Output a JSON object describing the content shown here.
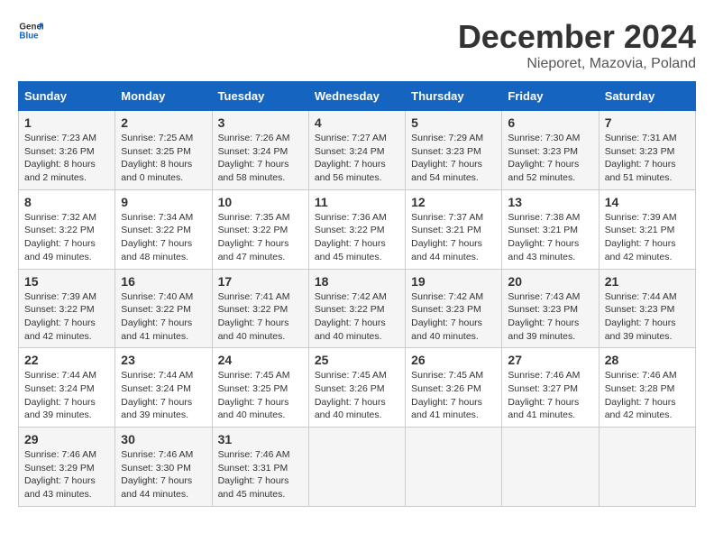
{
  "header": {
    "logo_general": "General",
    "logo_blue": "Blue",
    "main_title": "December 2024",
    "subtitle": "Nieporet, Mazovia, Poland"
  },
  "calendar": {
    "columns": [
      "Sunday",
      "Monday",
      "Tuesday",
      "Wednesday",
      "Thursday",
      "Friday",
      "Saturday"
    ],
    "weeks": [
      [
        {
          "day": "1",
          "sunrise": "7:23 AM",
          "sunset": "3:26 PM",
          "daylight": "8 hours and 2 minutes."
        },
        {
          "day": "2",
          "sunrise": "7:25 AM",
          "sunset": "3:25 PM",
          "daylight": "8 hours and 0 minutes."
        },
        {
          "day": "3",
          "sunrise": "7:26 AM",
          "sunset": "3:24 PM",
          "daylight": "7 hours and 58 minutes."
        },
        {
          "day": "4",
          "sunrise": "7:27 AM",
          "sunset": "3:24 PM",
          "daylight": "7 hours and 56 minutes."
        },
        {
          "day": "5",
          "sunrise": "7:29 AM",
          "sunset": "3:23 PM",
          "daylight": "7 hours and 54 minutes."
        },
        {
          "day": "6",
          "sunrise": "7:30 AM",
          "sunset": "3:23 PM",
          "daylight": "7 hours and 52 minutes."
        },
        {
          "day": "7",
          "sunrise": "7:31 AM",
          "sunset": "3:23 PM",
          "daylight": "7 hours and 51 minutes."
        }
      ],
      [
        {
          "day": "8",
          "sunrise": "7:32 AM",
          "sunset": "3:22 PM",
          "daylight": "7 hours and 49 minutes."
        },
        {
          "day": "9",
          "sunrise": "7:34 AM",
          "sunset": "3:22 PM",
          "daylight": "7 hours and 48 minutes."
        },
        {
          "day": "10",
          "sunrise": "7:35 AM",
          "sunset": "3:22 PM",
          "daylight": "7 hours and 47 minutes."
        },
        {
          "day": "11",
          "sunrise": "7:36 AM",
          "sunset": "3:22 PM",
          "daylight": "7 hours and 45 minutes."
        },
        {
          "day": "12",
          "sunrise": "7:37 AM",
          "sunset": "3:21 PM",
          "daylight": "7 hours and 44 minutes."
        },
        {
          "day": "13",
          "sunrise": "7:38 AM",
          "sunset": "3:21 PM",
          "daylight": "7 hours and 43 minutes."
        },
        {
          "day": "14",
          "sunrise": "7:39 AM",
          "sunset": "3:21 PM",
          "daylight": "7 hours and 42 minutes."
        }
      ],
      [
        {
          "day": "15",
          "sunrise": "7:39 AM",
          "sunset": "3:22 PM",
          "daylight": "7 hours and 42 minutes."
        },
        {
          "day": "16",
          "sunrise": "7:40 AM",
          "sunset": "3:22 PM",
          "daylight": "7 hours and 41 minutes."
        },
        {
          "day": "17",
          "sunrise": "7:41 AM",
          "sunset": "3:22 PM",
          "daylight": "7 hours and 40 minutes."
        },
        {
          "day": "18",
          "sunrise": "7:42 AM",
          "sunset": "3:22 PM",
          "daylight": "7 hours and 40 minutes."
        },
        {
          "day": "19",
          "sunrise": "7:42 AM",
          "sunset": "3:23 PM",
          "daylight": "7 hours and 40 minutes."
        },
        {
          "day": "20",
          "sunrise": "7:43 AM",
          "sunset": "3:23 PM",
          "daylight": "7 hours and 39 minutes."
        },
        {
          "day": "21",
          "sunrise": "7:44 AM",
          "sunset": "3:23 PM",
          "daylight": "7 hours and 39 minutes."
        }
      ],
      [
        {
          "day": "22",
          "sunrise": "7:44 AM",
          "sunset": "3:24 PM",
          "daylight": "7 hours and 39 minutes."
        },
        {
          "day": "23",
          "sunrise": "7:44 AM",
          "sunset": "3:24 PM",
          "daylight": "7 hours and 39 minutes."
        },
        {
          "day": "24",
          "sunrise": "7:45 AM",
          "sunset": "3:25 PM",
          "daylight": "7 hours and 40 minutes."
        },
        {
          "day": "25",
          "sunrise": "7:45 AM",
          "sunset": "3:26 PM",
          "daylight": "7 hours and 40 minutes."
        },
        {
          "day": "26",
          "sunrise": "7:45 AM",
          "sunset": "3:26 PM",
          "daylight": "7 hours and 41 minutes."
        },
        {
          "day": "27",
          "sunrise": "7:46 AM",
          "sunset": "3:27 PM",
          "daylight": "7 hours and 41 minutes."
        },
        {
          "day": "28",
          "sunrise": "7:46 AM",
          "sunset": "3:28 PM",
          "daylight": "7 hours and 42 minutes."
        }
      ],
      [
        {
          "day": "29",
          "sunrise": "7:46 AM",
          "sunset": "3:29 PM",
          "daylight": "7 hours and 43 minutes."
        },
        {
          "day": "30",
          "sunrise": "7:46 AM",
          "sunset": "3:30 PM",
          "daylight": "7 hours and 44 minutes."
        },
        {
          "day": "31",
          "sunrise": "7:46 AM",
          "sunset": "3:31 PM",
          "daylight": "7 hours and 45 minutes."
        },
        null,
        null,
        null,
        null
      ]
    ],
    "sunrise_label": "Sunrise:",
    "sunset_label": "Sunset:",
    "daylight_label": "Daylight:"
  }
}
